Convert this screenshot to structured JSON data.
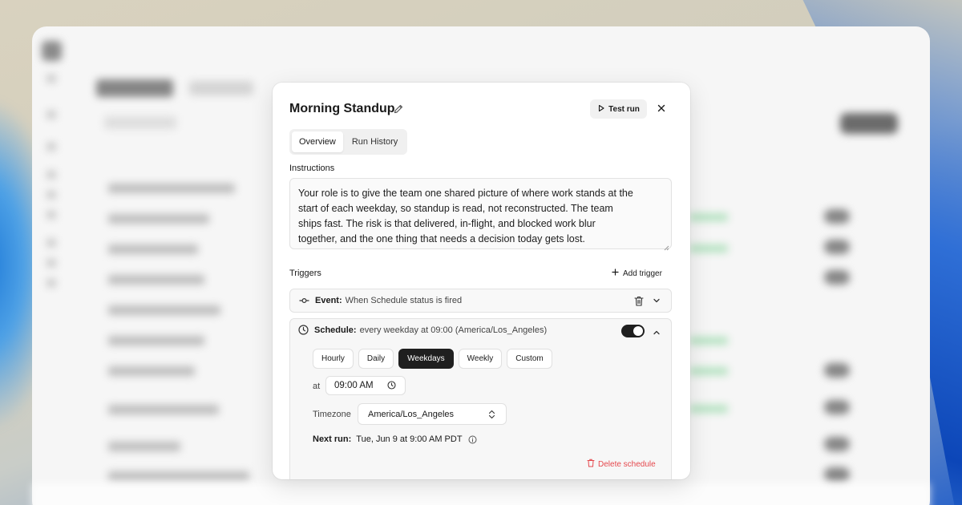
{
  "modal": {
    "title": "Morning Standup",
    "test_run_label": "Test run",
    "tabs": [
      {
        "label": "Overview",
        "active": true
      },
      {
        "label": "Run History",
        "active": false
      }
    ],
    "instructions": {
      "label": "Instructions",
      "value": "Your role is to give the team one shared picture of where work stands at the start of each weekday, so standup is read, not reconstructed. The team ships fast. The risk is that delivered, in-flight, and blocked work blur together, and the one thing that needs a decision today gets lost."
    },
    "triggers": {
      "label": "Triggers",
      "add_label": "Add trigger",
      "event": {
        "label": "Event:",
        "description": "When Schedule status is fired"
      },
      "schedule": {
        "label": "Schedule:",
        "description": "every weekday at 09:00 (America/Los_Angeles)",
        "enabled": true,
        "frequencies": [
          "Hourly",
          "Daily",
          "Weekdays",
          "Weekly",
          "Custom"
        ],
        "selected_frequency": "Weekdays",
        "at_label": "at",
        "time": "09:00 AM",
        "timezone_label": "Timezone",
        "timezone": "America/Los_Angeles",
        "next_run_label": "Next run:",
        "next_run": "Tue, Jun 9 at 9:00 AM PDT",
        "delete_label": "Delete schedule"
      }
    }
  },
  "colors": {
    "accent_dark": "#1f1f1f",
    "danger": "#e5484d"
  }
}
